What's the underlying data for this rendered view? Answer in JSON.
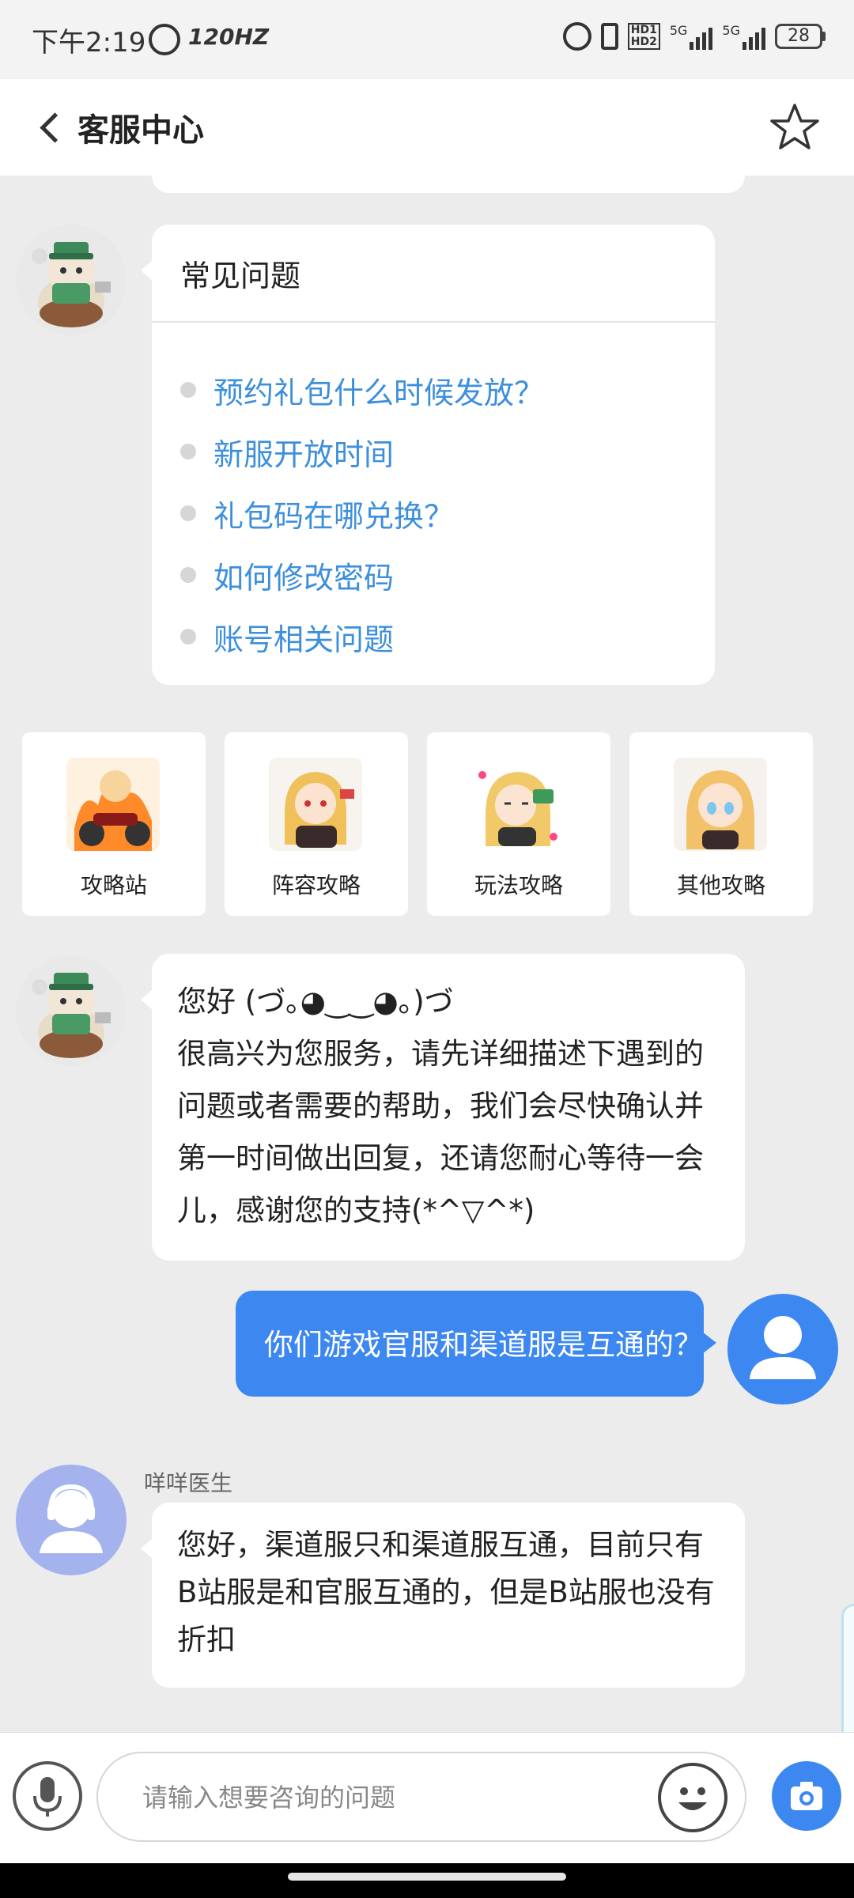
{
  "status_bar": {
    "time": "下午2:19",
    "refresh_rate": "120HZ",
    "hd_badge_top": "HD1",
    "hd_badge_bottom": "HD2",
    "network_1": "5G",
    "network_2": "5G",
    "battery": "28"
  },
  "header": {
    "title": "客服中心"
  },
  "faq": {
    "title": "常见问题",
    "items": [
      "预约礼包什么时候发放？",
      "新服开放时间",
      "礼包码在哪兑换？",
      "如何修改密码",
      "账号相关问题"
    ]
  },
  "tiles": [
    {
      "label": "攻略站"
    },
    {
      "label": "阵容攻略"
    },
    {
      "label": "玩法攻略"
    },
    {
      "label": "其他攻略"
    }
  ],
  "messages": {
    "bot_greeting_line1": "您好 (づ｡◕‿‿◕｡)づ",
    "bot_greeting_body": "很高兴为您服务，请先详细描述下遇到的问题或者需要的帮助，我们会尽快确认并第一时间做出回复，还请您耐心等待一会儿，感谢您的支持(*^▽^*)",
    "user_message": "你们游戏官服和渠道服是互通的？",
    "agent_name": "咩咩医生",
    "agent_reply": "您好，渠道服只和渠道服互通，目前只有B站服是和官服互通的，但是B站服也没有折扣"
  },
  "input": {
    "placeholder": "请输入想要咨询的问题"
  },
  "colors": {
    "accent_blue": "#3d88f0",
    "link_blue": "#3d8fdc",
    "background": "#ececec"
  }
}
